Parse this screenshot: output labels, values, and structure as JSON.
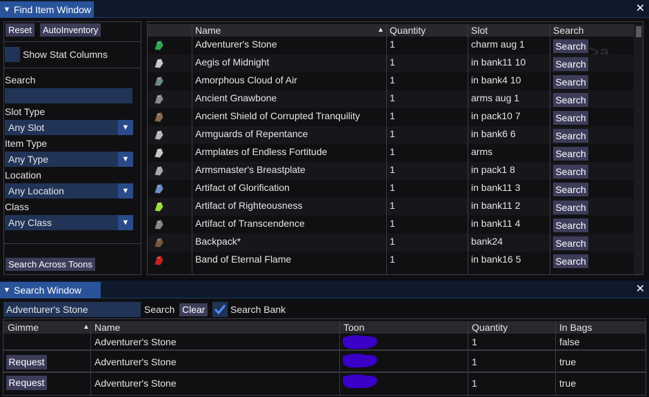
{
  "find_window": {
    "title": "Find Item Window",
    "close_glyph": "✕",
    "collapse_glyph": "▼",
    "buttons": {
      "reset": "Reset",
      "autoinventory": "AutoInventory",
      "search_across_toons": "Search Across Toons"
    },
    "show_stat_columns": "Show Stat Columns",
    "search_label": "Search",
    "search_value": "",
    "filters": [
      {
        "label": "Slot Type",
        "value": "Any Slot"
      },
      {
        "label": "Item Type",
        "value": "Any Type"
      },
      {
        "label": "Location",
        "value": "Any Location"
      },
      {
        "label": "Class",
        "value": "Any Class"
      }
    ],
    "columns": {
      "name": "Name",
      "quantity": "Quantity",
      "slot": "Slot",
      "search": "Search"
    },
    "sort_glyph": "▲",
    "row_button": "Search",
    "rows": [
      {
        "name": "Adventurer's Stone",
        "quantity": "1",
        "slot": "charm aug 1",
        "icon": "green-gem-icon",
        "color": "#2ea84a"
      },
      {
        "name": "Aegis of Midnight",
        "quantity": "1",
        "slot": "in bank11 10",
        "icon": "feather-icon",
        "color": "#c9c9c9"
      },
      {
        "name": "Amorphous Cloud of Air",
        "quantity": "1",
        "slot": "in bank4 10",
        "icon": "cloud-stone-icon",
        "color": "#6d8a86"
      },
      {
        "name": "Ancient Gnawbone",
        "quantity": "1",
        "slot": "arms aug 1",
        "icon": "bone-icon",
        "color": "#8a8a8a"
      },
      {
        "name": "Ancient Shield of Corrupted Tranquility",
        "quantity": "1",
        "slot": "in pack10 7",
        "icon": "shield-icon",
        "color": "#8a6a4a"
      },
      {
        "name": "Armguards of Repentance",
        "quantity": "1",
        "slot": "in bank6 6",
        "icon": "armguard-icon",
        "color": "#b8b8b8"
      },
      {
        "name": "Armplates of Endless Fortitude",
        "quantity": "1",
        "slot": "arms",
        "icon": "armplate-icon",
        "color": "#c8c8c8"
      },
      {
        "name": "Armsmaster's Breastplate",
        "quantity": "1",
        "slot": "in pack1 8",
        "icon": "breastplate-icon",
        "color": "#a9a9a9"
      },
      {
        "name": "Artifact of Glorification",
        "quantity": "1",
        "slot": "in bank11 3",
        "icon": "artifact-blue-icon",
        "color": "#6a8fc8"
      },
      {
        "name": "Artifact of Righteousness",
        "quantity": "1",
        "slot": "in bank11 2",
        "icon": "artifact-green-icon",
        "color": "#9be03a"
      },
      {
        "name": "Artifact of Transcendence",
        "quantity": "1",
        "slot": "in bank11 4",
        "icon": "artifact-grey-icon",
        "color": "#8a8a8a"
      },
      {
        "name": "Backpack*",
        "quantity": "1",
        "slot": "bank24",
        "icon": "backpack-icon",
        "color": "#7a5a3a"
      },
      {
        "name": "Band of Eternal Flame",
        "quantity": "1",
        "slot": "in bank16 5",
        "icon": "red-band-icon",
        "color": "#c82020"
      }
    ]
  },
  "search_window": {
    "title": "Search Window",
    "close_glyph": "✕",
    "collapse_glyph": "▼",
    "query": "Adventurer's Stone",
    "search_label": "Search",
    "clear_label": "Clear",
    "search_bank_label": "Search Bank",
    "search_bank_checked": true,
    "columns": {
      "gimme": "Gimme",
      "name": "Name",
      "toon": "Toon",
      "quantity": "Quantity",
      "in_bags": "In Bags"
    },
    "request_label": "Request",
    "rows": [
      {
        "has_request": false,
        "name": "Adventurer's Stone",
        "quantity": "1",
        "in_bags": "false"
      },
      {
        "has_request": true,
        "name": "Adventurer's Stone",
        "quantity": "1",
        "in_bags": "true"
      },
      {
        "has_request": true,
        "name": "Adventurer's Stone",
        "quantity": "1",
        "in_bags": "true"
      }
    ],
    "redaction_color": "#3a00c8"
  }
}
